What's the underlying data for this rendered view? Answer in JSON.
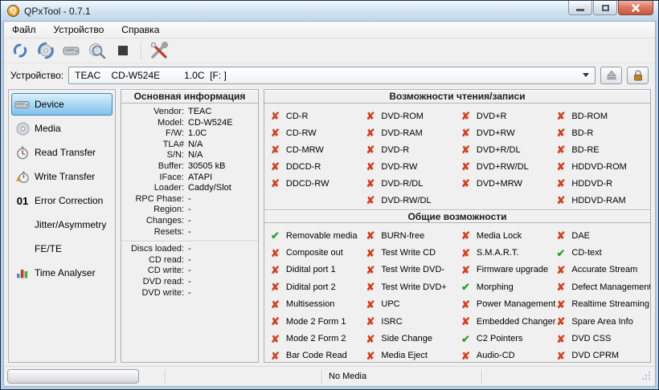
{
  "window": {
    "title": "QPxTool - 0.7.1",
    "controls": {
      "minimize": "minimize",
      "maximize": "maximize",
      "close": "close"
    }
  },
  "menu": {
    "items": [
      {
        "label": "Файл"
      },
      {
        "label": "Устройство"
      },
      {
        "label": "Справка"
      }
    ]
  },
  "toolbar": {
    "icons": [
      "refresh-icon",
      "media-refresh-icon",
      "drive-icon",
      "scan-icon",
      "stop-icon",
      "preferences-icon"
    ]
  },
  "device_bar": {
    "label": "Устройство:",
    "value": "TEAC    CD-W524E         1.0C  [F: ]",
    "buttons": [
      "eject",
      "lock"
    ]
  },
  "sidebar": {
    "items": [
      {
        "label": "Device",
        "icon": "drive-icon",
        "selected": true
      },
      {
        "label": "Media",
        "icon": "disc-icon",
        "selected": false
      },
      {
        "label": "Read Transfer",
        "icon": "stopwatch-icon",
        "selected": false
      },
      {
        "label": "Write Transfer",
        "icon": "write-stopwatch-icon",
        "selected": false
      },
      {
        "label": "Error Correction",
        "icon": "zero-one-icon",
        "selected": false
      },
      {
        "label": "Jitter/Asymmetry",
        "icon": "",
        "selected": false
      },
      {
        "label": "FE/TE",
        "icon": "",
        "selected": false
      },
      {
        "label": "Time Analyser",
        "icon": "bar-chart-icon",
        "selected": false
      }
    ]
  },
  "info_panel": {
    "title": "Основная информация",
    "rows": [
      {
        "label": "Vendor:",
        "value": "TEAC"
      },
      {
        "label": "Model:",
        "value": "CD-W524E"
      },
      {
        "label": "F/W:",
        "value": "1.0C"
      },
      {
        "label": "TLA#",
        "value": "N/A"
      },
      {
        "label": "S/N:",
        "value": "N/A"
      },
      {
        "label": "Buffer:",
        "value": "30505 kB"
      },
      {
        "label": "IFace:",
        "value": "ATAPI"
      },
      {
        "label": "Loader:",
        "value": "Caddy/Slot"
      },
      {
        "label": "RPC Phase:",
        "value": "-"
      },
      {
        "label": "Region:",
        "value": "-"
      },
      {
        "label": "Changes:",
        "value": "-"
      },
      {
        "label": "Resets:",
        "value": "-"
      }
    ],
    "rows2": [
      {
        "label": "Discs loaded:",
        "value": "-"
      },
      {
        "label": "CD read:",
        "value": "-"
      },
      {
        "label": "CD write:",
        "value": "-"
      },
      {
        "label": "DVD read:",
        "value": "-"
      },
      {
        "label": "DVD write:",
        "value": "-"
      }
    ]
  },
  "capabilities": {
    "rw_title": "Возможности чтения/записи",
    "general_title": "Общие возможности",
    "rw_columns": [
      [
        {
          "label": "CD-R",
          "ok": false
        },
        {
          "label": "CD-RW",
          "ok": false
        },
        {
          "label": "CD-MRW",
          "ok": false
        },
        {
          "label": "DDCD-R",
          "ok": false
        },
        {
          "label": "DDCD-RW",
          "ok": false
        }
      ],
      [
        {
          "label": "DVD-ROM",
          "ok": false
        },
        {
          "label": "DVD-RAM",
          "ok": false
        },
        {
          "label": "DVD-R",
          "ok": false
        },
        {
          "label": "DVD-RW",
          "ok": false
        },
        {
          "label": "DVD-R/DL",
          "ok": false
        },
        {
          "label": "DVD-RW/DL",
          "ok": false
        }
      ],
      [
        {
          "label": "DVD+R",
          "ok": false
        },
        {
          "label": "DVD+RW",
          "ok": false
        },
        {
          "label": "DVD+R/DL",
          "ok": false
        },
        {
          "label": "DVD+RW/DL",
          "ok": false
        },
        {
          "label": "DVD+MRW",
          "ok": false
        }
      ],
      [
        {
          "label": "BD-ROM",
          "ok": false
        },
        {
          "label": "BD-R",
          "ok": false
        },
        {
          "label": "BD-RE",
          "ok": false
        },
        {
          "label": "HDDVD-ROM",
          "ok": false
        },
        {
          "label": "HDDVD-R",
          "ok": false
        },
        {
          "label": "HDDVD-RAM",
          "ok": false
        }
      ]
    ],
    "general_columns": [
      [
        {
          "label": "Removable media",
          "ok": true
        },
        {
          "label": "Composite out",
          "ok": false
        },
        {
          "label": "Didital port 1",
          "ok": false
        },
        {
          "label": "Didital port 2",
          "ok": false
        },
        {
          "label": "Multisession",
          "ok": false
        },
        {
          "label": "Mode 2 Form 1",
          "ok": false
        },
        {
          "label": "Mode 2 Form 2",
          "ok": false
        },
        {
          "label": "Bar Code Read",
          "ok": false
        }
      ],
      [
        {
          "label": "BURN-free",
          "ok": false
        },
        {
          "label": "Test Write CD",
          "ok": false
        },
        {
          "label": "Test Write DVD-",
          "ok": false
        },
        {
          "label": "Test Write DVD+",
          "ok": false
        },
        {
          "label": "UPC",
          "ok": false
        },
        {
          "label": "ISRC",
          "ok": false
        },
        {
          "label": "Side Change",
          "ok": false
        },
        {
          "label": "Media Eject",
          "ok": false
        }
      ],
      [
        {
          "label": "Media Lock",
          "ok": false
        },
        {
          "label": "S.M.A.R.T.",
          "ok": false
        },
        {
          "label": "Firmware upgrade",
          "ok": false
        },
        {
          "label": "Morphing",
          "ok": true
        },
        {
          "label": "Power Management",
          "ok": false
        },
        {
          "label": "Embedded Changer",
          "ok": false
        },
        {
          "label": "C2 Pointers",
          "ok": true
        },
        {
          "label": "Audio-CD",
          "ok": false
        }
      ],
      [
        {
          "label": "DAE",
          "ok": false
        },
        {
          "label": "CD-text",
          "ok": true
        },
        {
          "label": "Accurate Stream",
          "ok": false
        },
        {
          "label": "Defect Management",
          "ok": false
        },
        {
          "label": "Realtime Streaming",
          "ok": false
        },
        {
          "label": "Spare Area Info",
          "ok": false
        },
        {
          "label": "DVD CSS",
          "ok": false
        },
        {
          "label": "DVD CPRM",
          "ok": false
        }
      ]
    ]
  },
  "statusbar": {
    "media": "No Media"
  },
  "icons": {
    "check_glyph": "✔",
    "cross_glyph": "✘",
    "app_logo_glyph": "Q"
  },
  "colors": {
    "selection_blue": "#7fc2ec",
    "selection_border": "#3f87b5",
    "check_green": "#2fa12f",
    "cross_red": "#d63f1e",
    "titlebar_blue": "#cfe2f2",
    "close_red": "#dd7a63",
    "lock_orange": "#c77f2e"
  }
}
